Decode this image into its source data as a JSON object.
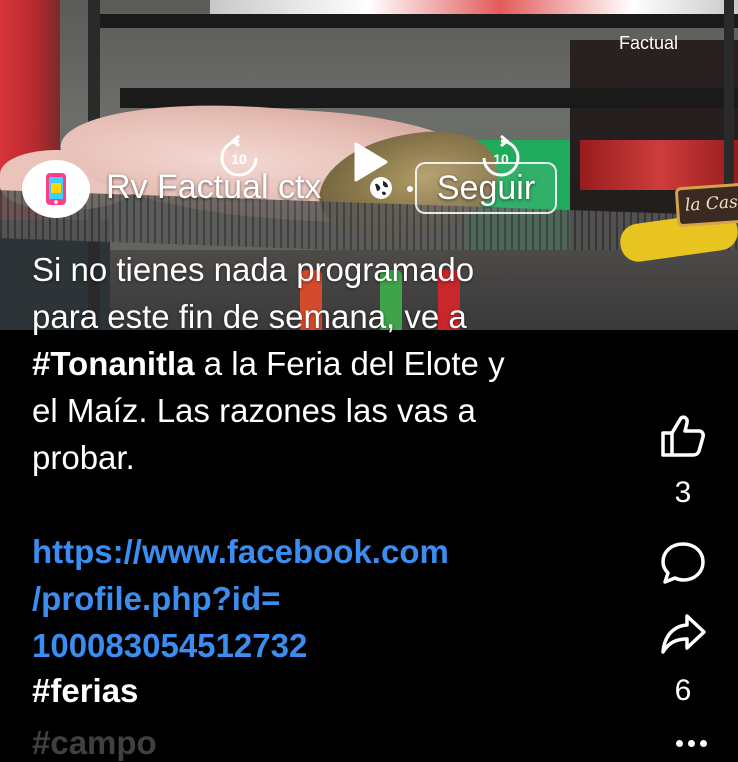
{
  "video": {
    "watermark": "Factual",
    "sign_text": "la Cas",
    "replay_seconds": "10",
    "forward_seconds": "10"
  },
  "account": {
    "name": "Rv Factual ctx",
    "follow_label": "Seguir"
  },
  "caption": {
    "line1": "Si no tienes nada programado",
    "line2": "para este fin de semana, ve a",
    "hashtag": "#Tonanitla",
    "line3_rest": " a la Feria del Elote y",
    "line4": "el Maíz.  Las razones las vas a",
    "line5": "probar."
  },
  "link": {
    "part1": "https://www.facebook.com",
    "part2": "/profile.php?id=",
    "part3": "100083054512732"
  },
  "tags": {
    "tag1": "#ferias",
    "tag2": "#campo"
  },
  "actions": {
    "like_count": "3",
    "share_count": "6"
  },
  "icons": {
    "like": "thumbs-up-icon",
    "comment": "comment-icon",
    "share": "share-icon",
    "more": "more-dots-icon",
    "globe": "globe-icon",
    "play": "play-icon"
  }
}
